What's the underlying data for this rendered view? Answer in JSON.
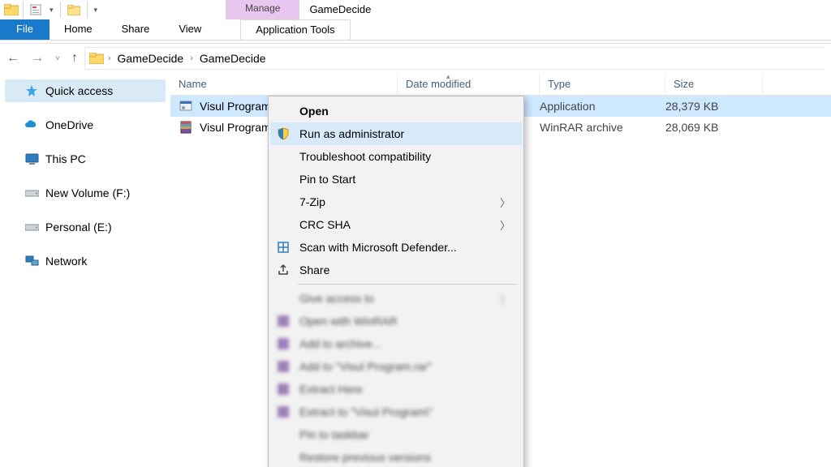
{
  "titlebar": {
    "manage_tab": "Manage",
    "window_title": "GameDecide"
  },
  "ribbon": {
    "file": "File",
    "home": "Home",
    "share": "Share",
    "view": "View",
    "app_tools": "Application Tools"
  },
  "breadcrumb": {
    "root": "GameDecide",
    "current": "GameDecide"
  },
  "sidebar": {
    "items": [
      {
        "label": "Quick access",
        "icon": "star-icon"
      },
      {
        "label": "OneDrive",
        "icon": "cloud-icon"
      },
      {
        "label": "This PC",
        "icon": "monitor-icon"
      },
      {
        "label": "New Volume (F:)",
        "icon": "drive-icon"
      },
      {
        "label": "Personal (E:)",
        "icon": "drive-icon"
      },
      {
        "label": "Network",
        "icon": "network-icon"
      }
    ]
  },
  "columns": {
    "name": "Name",
    "date": "Date modified",
    "type": "Type",
    "size": "Size"
  },
  "files": [
    {
      "name": "Visul Program",
      "date": "",
      "type": "Application",
      "size": "28,379 KB",
      "icon": "exe-icon",
      "selected": true
    },
    {
      "name": "Visul Program",
      "date": "",
      "type": "WinRAR archive",
      "size": "28,069 KB",
      "icon": "rar-icon",
      "selected": false
    }
  ],
  "context_menu": {
    "open": "Open",
    "run_admin": "Run as administrator",
    "troubleshoot": "Troubleshoot compatibility",
    "pin_start": "Pin to Start",
    "sevenzip": "7-Zip",
    "crcsha": "CRC SHA",
    "defender": "Scan with Microsoft Defender...",
    "share": "Share",
    "blurred": [
      "Give access to",
      "Open with WinRAR",
      "Add to archive...",
      "Add to \"Visul Program.rar\"",
      "Extract Here",
      "Extract to \"Visul Program\\\"",
      "Pin to taskbar",
      "Restore previous versions"
    ]
  }
}
